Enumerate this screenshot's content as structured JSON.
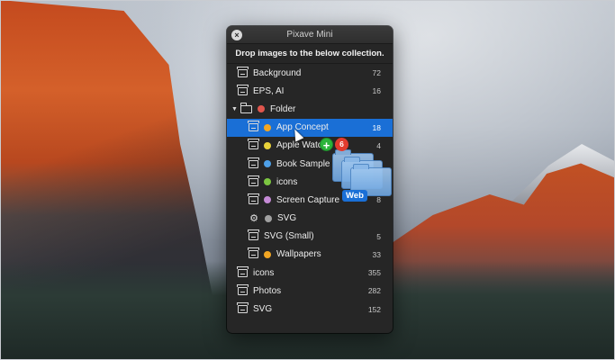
{
  "window": {
    "title": "Pixave Mini",
    "close_glyph": "×",
    "drop_hint": "Drop images to the below collection."
  },
  "collections": [
    {
      "label": "Background",
      "count": "72",
      "icon": "tray-icon",
      "indent": 0
    },
    {
      "label": "EPS, AI",
      "count": "16",
      "icon": "tray-icon",
      "indent": 0
    },
    {
      "label": "Folder",
      "count": "",
      "icon": "folder-icon",
      "indent": 0,
      "disclosure": "▼",
      "dot": "#e0564d"
    },
    {
      "label": "App Concept",
      "count": "18",
      "icon": "tray-icon",
      "indent": 1,
      "dot": "#f2a623",
      "selected": true
    },
    {
      "label": "Apple Watch",
      "count": "4",
      "icon": "tray-icon",
      "indent": 1,
      "dot": "#e9d23a"
    },
    {
      "label": "Book Sample",
      "count": "",
      "icon": "tray-icon",
      "indent": 1,
      "dot": "#4ea0e8"
    },
    {
      "label": "icons",
      "count": "",
      "icon": "tray-icon",
      "indent": 1,
      "dot": "#7cc641"
    },
    {
      "label": "Screen Capture",
      "count": "8",
      "icon": "tray-icon",
      "indent": 1,
      "dot": "#c58ad6"
    },
    {
      "label": "SVG",
      "count": "",
      "icon": "gear-icon",
      "indent": 1,
      "dot": "#a0a0a0"
    },
    {
      "label": "SVG (Small)",
      "count": "5",
      "icon": "tray-icon",
      "indent": 1
    },
    {
      "label": "Wallpapers",
      "count": "33",
      "icon": "tray-icon",
      "indent": 1,
      "dot": "#f2a623"
    },
    {
      "label": "icons",
      "count": "355",
      "icon": "tray-icon",
      "indent": 0
    },
    {
      "label": "Photos",
      "count": "282",
      "icon": "tray-icon",
      "indent": 0
    },
    {
      "label": "SVG",
      "count": "152",
      "icon": "tray-icon",
      "indent": 0
    }
  ],
  "drag": {
    "plus_glyph": "+",
    "item_count": "6",
    "drop_label": "Web"
  },
  "colors": {
    "selection": "#1a6fd6",
    "window_bg": "#262626"
  }
}
